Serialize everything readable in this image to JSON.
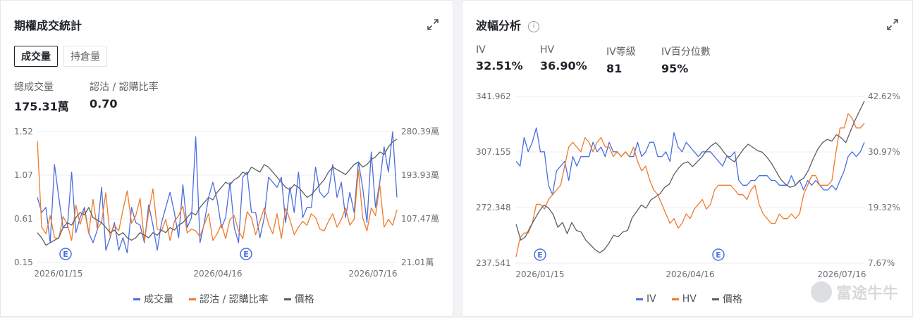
{
  "colors": {
    "volume": "#4a6ee0",
    "ratio": "#f07a2b",
    "price": "#5a5f66",
    "iv": "#4a6ee0",
    "hv": "#f07a2b"
  },
  "card1": {
    "title": "期權成交統計",
    "tabs": [
      {
        "label": "成交量",
        "active": true
      },
      {
        "label": "持倉量",
        "active": false
      }
    ],
    "stats": [
      {
        "label": "總成交量",
        "value": "175.31萬"
      },
      {
        "label": "認沽 / 認購比率",
        "value": "0.70"
      }
    ],
    "legend": [
      "成交量",
      "認沽 / 認購比率",
      "價格"
    ]
  },
  "card2": {
    "title": "波幅分析",
    "info_icon": "info-icon",
    "stats": [
      {
        "label": "IV",
        "value": "32.51%"
      },
      {
        "label": "HV",
        "value": "36.90%"
      },
      {
        "label": "IV等級",
        "value": "81"
      },
      {
        "label": "IV百分位數",
        "value": "95%"
      }
    ],
    "legend": [
      "IV",
      "HV",
      "價格"
    ],
    "watermark": "富途牛牛"
  },
  "chart_data": [
    {
      "type": "line",
      "title": "期權成交統計",
      "x_ticks": [
        "2026/01/15",
        "2026/04/16",
        "2026/07/16"
      ],
      "left_axis_ticks": [
        "1.52",
        "1.07",
        "0.61",
        "0.15"
      ],
      "right_axis_ticks": [
        "280.39萬",
        "193.93萬",
        "107.47萬",
        "21.01萬"
      ],
      "left_range": [
        0.15,
        1.52
      ],
      "right_range_wan": [
        21.01,
        280.39
      ],
      "event_markers": [
        "E",
        "E"
      ],
      "grid": true,
      "legend_position": "bottom",
      "series": [
        {
          "name": "成交量",
          "axis": "right",
          "values_wan": [
            150,
            120,
            130,
            60,
            215,
            150,
            90,
            90,
            200,
            80,
            110,
            130,
            80,
            60,
            85,
            170,
            45,
            70,
            100,
            45,
            70,
            40,
            130,
            100,
            95,
            60,
            135,
            95,
            45,
            100,
            130,
            160,
            120,
            70,
            175,
            90,
            110,
            270,
            60,
            100,
            150,
            180,
            145,
            90,
            110,
            180,
            90,
            60,
            190,
            200,
            120,
            120,
            70,
            110,
            190,
            180,
            170,
            190,
            100,
            170,
            120,
            200,
            110,
            130,
            130,
            210,
            160,
            150,
            160,
            215,
            150,
            180,
            110,
            160,
            120,
            220,
            170,
            100,
            240,
            130,
            180,
            250,
            200,
            280,
            150
          ]
        },
        {
          "name": "認沽 / 認購比率",
          "axis": "left",
          "values": [
            1.42,
            0.52,
            0.45,
            0.64,
            0.41,
            0.4,
            0.63,
            0.55,
            0.38,
            0.75,
            0.55,
            0.7,
            0.45,
            0.81,
            0.5,
            0.57,
            0.88,
            0.42,
            0.54,
            0.48,
            0.7,
            0.9,
            0.56,
            0.64,
            0.82,
            0.37,
            0.68,
            0.92,
            0.5,
            0.48,
            0.6,
            0.38,
            0.58,
            0.64,
            0.74,
            0.46,
            0.5,
            0.48,
            0.42,
            0.55,
            0.66,
            0.38,
            0.45,
            0.55,
            0.4,
            0.6,
            0.64,
            0.48,
            0.4,
            0.68,
            0.62,
            0.44,
            0.58,
            0.72,
            0.55,
            0.45,
            0.66,
            0.4,
            0.72,
            0.6,
            0.44,
            0.52,
            0.58,
            0.54,
            0.66,
            0.62,
            0.5,
            0.48,
            0.58,
            0.66,
            0.52,
            0.6,
            0.72,
            0.54,
            0.6,
            1.12,
            0.62,
            0.48,
            0.72,
            0.64,
            0.96,
            0.52,
            0.6,
            0.54,
            0.7
          ]
        },
        {
          "name": "價格",
          "axis": "right",
          "values_wan": [
            80,
            70,
            55,
            60,
            65,
            70,
            90,
            100,
            95,
            110,
            120,
            115,
            130,
            110,
            105,
            100,
            90,
            80,
            85,
            75,
            80,
            70,
            65,
            70,
            80,
            75,
            70,
            80,
            75,
            85,
            80,
            90,
            85,
            95,
            100,
            110,
            120,
            115,
            130,
            140,
            150,
            145,
            160,
            170,
            180,
            175,
            185,
            190,
            200,
            195,
            210,
            205,
            200,
            215,
            210,
            200,
            190,
            180,
            170,
            165,
            175,
            170,
            160,
            150,
            155,
            165,
            175,
            185,
            200,
            210,
            205,
            200,
            195,
            205,
            215,
            220,
            210,
            215,
            225,
            230,
            240,
            235,
            250,
            260,
            265
          ]
        }
      ]
    },
    {
      "type": "line",
      "title": "波幅分析",
      "x_ticks": [
        "2026/01/15",
        "2026/04/16",
        "2026/07/16"
      ],
      "left_axis_ticks": [
        "341.962",
        "307.155",
        "272.348",
        "237.541"
      ],
      "right_axis_ticks": [
        "42.62%",
        "30.97%",
        "19.32%",
        "7.67%"
      ],
      "left_range": [
        237.541,
        341.962
      ],
      "right_range_pct": [
        7.67,
        42.62
      ],
      "event_markers": [
        "E",
        "E"
      ],
      "grid": true,
      "legend_position": "bottom",
      "series": [
        {
          "name": "IV",
          "axis": "right",
          "values": [
            29,
            28,
            34,
            31,
            33,
            36,
            31,
            31,
            24,
            22,
            27,
            28,
            29,
            25,
            30,
            28,
            30,
            30,
            30,
            33,
            31,
            32,
            30,
            33,
            31,
            31,
            30,
            31,
            30,
            30,
            33,
            30,
            31,
            33,
            33,
            30,
            30,
            31,
            29,
            35,
            32,
            31,
            33,
            32,
            31,
            30,
            31,
            31,
            31,
            30,
            29,
            28,
            30,
            30,
            31,
            25,
            24,
            24,
            25,
            25,
            26,
            26,
            26,
            25,
            25,
            24,
            24,
            24,
            26,
            24,
            25,
            23,
            25,
            24,
            25,
            24,
            23,
            23,
            24,
            23,
            25,
            27,
            30,
            31,
            30,
            31,
            33
          ]
        },
        {
          "name": "HV",
          "axis": "right",
          "values": [
            9,
            13,
            14,
            14,
            16,
            20,
            20,
            19,
            21,
            22,
            23,
            24,
            28,
            32,
            33,
            32,
            31,
            34,
            33,
            31,
            33,
            34,
            32,
            32,
            30,
            31,
            30,
            31,
            30,
            32,
            29,
            27,
            28,
            25,
            23,
            22,
            20,
            18,
            16,
            17,
            15,
            16,
            18,
            17,
            19,
            20,
            21,
            19,
            20,
            23,
            24,
            24,
            24,
            24,
            23,
            22,
            22,
            21,
            23,
            24,
            20,
            18,
            17,
            16,
            16,
            18,
            17,
            17,
            18,
            17,
            18,
            22,
            24,
            26,
            26,
            24,
            24,
            24,
            25,
            31,
            36,
            36,
            39,
            38,
            36,
            36,
            37
          ]
        },
        {
          "name": "價格",
          "axis": "left",
          "values": [
            262,
            252,
            254,
            260,
            265,
            270,
            274,
            272,
            268,
            260,
            263,
            256,
            263,
            258,
            257,
            252,
            249,
            246,
            244,
            246,
            250,
            255,
            254,
            257,
            258,
            266,
            270,
            274,
            272,
            277,
            279,
            281,
            285,
            287,
            293,
            297,
            300,
            301,
            298,
            301,
            304,
            308,
            311,
            313,
            310,
            306,
            303,
            301,
            305,
            309,
            312,
            310,
            308,
            307,
            304,
            300,
            295,
            290,
            287,
            285,
            286,
            289,
            291,
            296,
            303,
            309,
            313,
            315,
            314,
            318,
            316,
            313,
            320,
            327,
            333,
            339
          ]
        }
      ]
    }
  ]
}
